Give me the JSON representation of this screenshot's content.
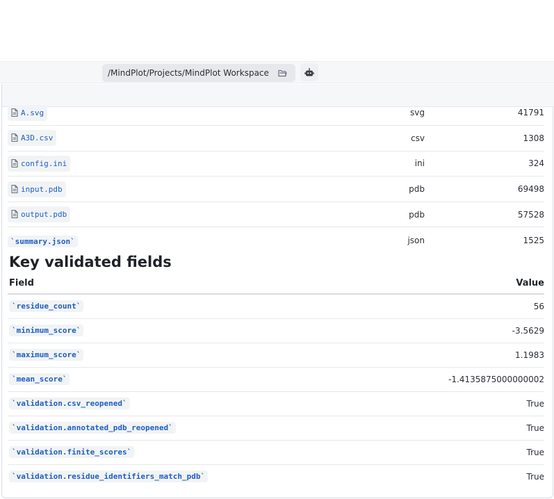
{
  "workspace": {
    "path": "/MindPlot/Projects/MindPlot Workspace",
    "folder_icon": "folder-open-icon",
    "assistant_icon": "robot-icon"
  },
  "files": [
    {
      "name": "A.svg",
      "type": "svg",
      "size": "41791"
    },
    {
      "name": "A3D.csv",
      "type": "csv",
      "size": "1308"
    },
    {
      "name": "config.ini",
      "type": "ini",
      "size": "324"
    },
    {
      "name": "input.pdb",
      "type": "pdb",
      "size": "69498"
    },
    {
      "name": "output.pdb",
      "type": "pdb",
      "size": "57528"
    },
    {
      "name": "`summary.json`",
      "type": "json",
      "size": "1525"
    }
  ],
  "validated": {
    "title": "Key validated fields",
    "col_field": "Field",
    "col_value": "Value",
    "rows": [
      {
        "field": "`residue_count`",
        "value": "56"
      },
      {
        "field": "`minimum_score`",
        "value": "-3.5629"
      },
      {
        "field": "`maximum_score`",
        "value": "1.1983"
      },
      {
        "field": "`mean_score`",
        "value": "-1.4135875000000002"
      },
      {
        "field": "`validation.csv_reopened`",
        "value": "True"
      },
      {
        "field": "`validation.annotated_pdb_reopened`",
        "value": "True"
      },
      {
        "field": "`validation.finite_scores`",
        "value": "True"
      },
      {
        "field": "`validation.residue_identifiers_match_pdb`",
        "value": "True"
      }
    ]
  },
  "colors": {
    "link": "#1f5fbf",
    "chip_bg": "#f1f3f5",
    "bar_bg": "#f6f7f9"
  }
}
